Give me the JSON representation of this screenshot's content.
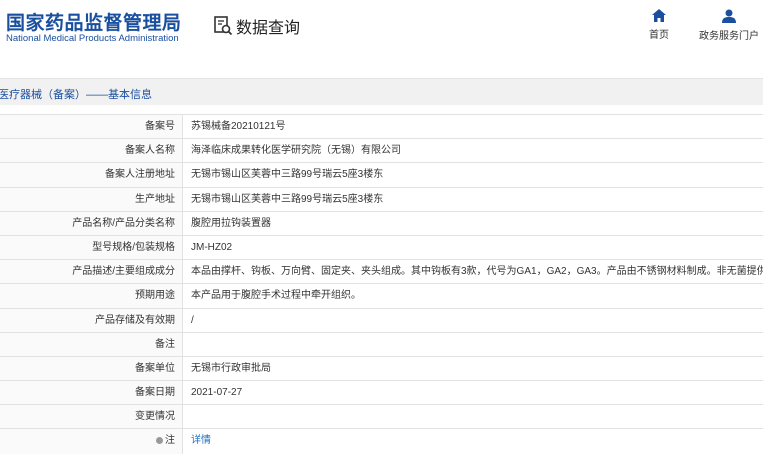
{
  "header": {
    "logo_cn": "国家药品监督管理局",
    "logo_en": "National Medical Products Administration",
    "query_label": "数据查询",
    "nav": [
      {
        "label": "首页",
        "icon": "home-icon"
      },
      {
        "label": "政务服务门户",
        "icon": "user-icon"
      }
    ]
  },
  "breadcrumb": "医疗器械（备案）——基本信息",
  "rows": [
    {
      "label": "备案号",
      "value": "苏锡械备20210121号"
    },
    {
      "label": "备案人名称",
      "value": "海泽临床成果转化医学研究院（无锡）有限公司"
    },
    {
      "label": "备案人注册地址",
      "value": "无锡市锡山区芙蓉中三路99号瑞云5座3楼东"
    },
    {
      "label": "生产地址",
      "value": "无锡市锡山区芙蓉中三路99号瑞云5座3楼东"
    },
    {
      "label": "产品名称/产品分类名称",
      "value": "腹腔用拉钩装置器"
    },
    {
      "label": "型号规格/包装规格",
      "value": "JM-HZ02"
    },
    {
      "label": "产品描述/主要组成成分",
      "value": "本品由撑杆、钩板、万向臂、固定夹、夹头组成。其中钩板有3款，代号为GA1，GA2，GA3。产品由不锈钢材料制成。非无菌提供。"
    },
    {
      "label": "预期用途",
      "value": "本产品用于腹腔手术过程中牵开组织。"
    },
    {
      "label": "产品存储及有效期",
      "value": "/"
    },
    {
      "label": "备注",
      "value": ""
    },
    {
      "label": "备案单位",
      "value": "无锡市行政审批局"
    },
    {
      "label": "备案日期",
      "value": "2021-07-27"
    },
    {
      "label": "变更情况",
      "value": ""
    },
    {
      "label": "注",
      "value": "详情"
    }
  ],
  "colors": {
    "brand": "#1a4fa0",
    "link": "#1a6fc4"
  }
}
